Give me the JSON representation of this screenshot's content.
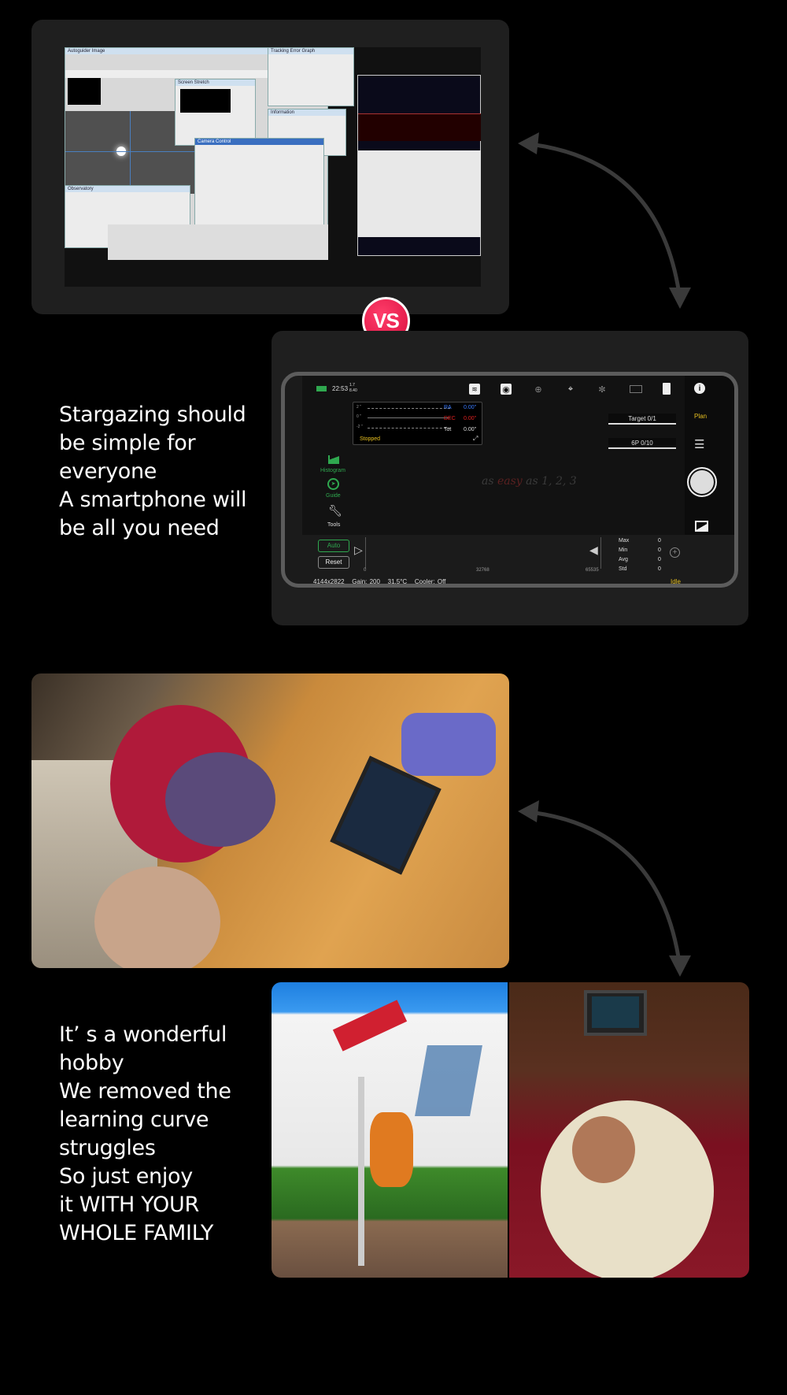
{
  "legacy_screenshot": {
    "windows": [
      "Autoguider Image",
      "Screen Stretch",
      "Tracking Error Graph",
      "Information",
      "Camera Control",
      "Observatory"
    ]
  },
  "vs_badge": {
    "label": "VS",
    "color": "#e8194a"
  },
  "slogan_1": "Stargazing should\nbe simple for\neveryone\nA smartphone will\nbe all you need",
  "phone_app": {
    "status": {
      "time": "22:53",
      "small_top": "1.7",
      "small_bottom": "8.40"
    },
    "top_icons": [
      "wifi-icon",
      "camera-icon",
      "focuser-icon",
      "telescope-icon",
      "filter-wheel-icon",
      "guide-camera-icon",
      "sd-card-icon"
    ],
    "guide": {
      "y_labels": [
        "2 \"",
        "0 \"",
        "-2 \""
      ],
      "ra_label": "RA",
      "ra_value": "0.00\"",
      "dec_label": "DEC",
      "dec_value": "0.00\"",
      "tot_label": "Tot",
      "tot_value": "0.00\"",
      "state": "Stopped"
    },
    "targets": {
      "target": "Target  0/1",
      "sequence": "6P  0/10"
    },
    "left_tools": {
      "histogram": "Histogram",
      "guide": "Guide",
      "tools": "Tools"
    },
    "watermark": {
      "a": "as",
      "b": "easy",
      "c": "as 1, 2, 3"
    },
    "right": {
      "plan": "Plan"
    },
    "histogram": {
      "auto": "Auto",
      "reset": "Reset",
      "ticks": [
        "0",
        "32768",
        "65535"
      ],
      "stats": [
        {
          "k": "Max",
          "v": "0"
        },
        {
          "k": "Min",
          "v": "0"
        },
        {
          "k": "Avg",
          "v": "0"
        },
        {
          "k": "Std",
          "v": "0"
        }
      ]
    },
    "footer": {
      "resolution": "4144x2822",
      "gain": "Gain: 200",
      "temp": "31.5°C",
      "cooler": "Cooler: Off",
      "state": "Idle"
    },
    "colors": {
      "green": "#2fa84f",
      "accent": "#e8c020",
      "ra": "#3a7bff",
      "dec": "#e02020"
    }
  },
  "slogan_2": "It’ s a wonderful\nhobby\nWe removed the\nlearning curve\nstruggles\nSo just enjoy\nit WITH YOUR\nWHOLE FAMILY"
}
